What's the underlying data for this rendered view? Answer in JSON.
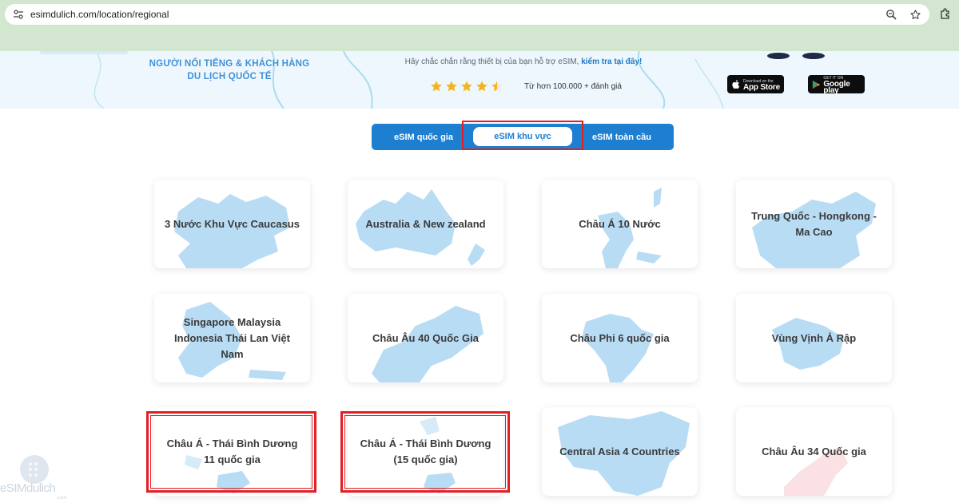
{
  "browser": {
    "url": "esimdulich.com/location/regional"
  },
  "hero": {
    "left_line1": "NGƯỜI NỔI TIẾNG & KHÁCH HÀNG",
    "left_line2": "DU LỊCH QUỐC TẾ",
    "subtitle": "Hãy chắc chắn rằng thiết bị của bạn hỗ trợ eSIM,",
    "subtitle_link": "kiểm tra tại đây!",
    "rating_value": 4.5,
    "rating_max": 5,
    "rating_text": "Từ hơn 100.000 + đánh giá",
    "app_store_small": "Download on the",
    "app_store_big": "App Store",
    "google_play_small": "GET IT ON",
    "google_play_big": "Google play"
  },
  "tabs": [
    {
      "label": "eSIM quốc gia",
      "active": false
    },
    {
      "label": "eSIM khu vực",
      "active": true
    },
    {
      "label": "eSIM toàn cầu",
      "active": false
    }
  ],
  "cards": [
    {
      "label": "3 Nước Khu Vực Caucasus"
    },
    {
      "label": "Australia & New zealand"
    },
    {
      "label": "Châu Á 10 Nước"
    },
    {
      "label": "Trung Quốc - Hongkong - Ma Cao"
    },
    {
      "label": "Singapore Malaysia Indonesia Thái Lan Việt Nam"
    },
    {
      "label": "Châu Âu 40 Quốc Gia"
    },
    {
      "label": "Châu Phi 6 quốc gia"
    },
    {
      "label": "Vùng Vịnh Ả Rập"
    },
    {
      "label": "Châu Á - Thái Bình Dương 11 quốc gia"
    },
    {
      "label": "Châu Á - Thái Bình Dương (15 quốc gia)"
    },
    {
      "label": "Central Asia 4 Countries"
    },
    {
      "label": "Châu Âu 34 Quốc gia"
    }
  ],
  "watermark": {
    "text": "eSIMdulich",
    "suffix": ".com"
  },
  "colors": {
    "brand_blue": "#1e7fd1",
    "highlight_red": "#e31e24",
    "map_blue": "#b9dcf5",
    "star_yellow": "#f6b31b",
    "chrome_green": "#d3e6cf"
  }
}
